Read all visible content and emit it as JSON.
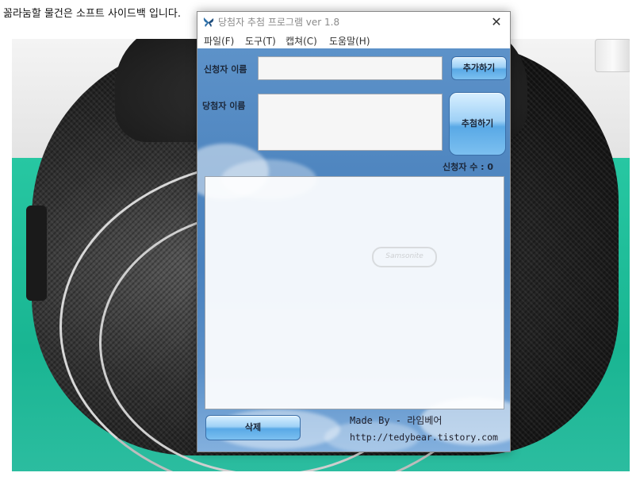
{
  "page": {
    "top_text": "꼶라눔할 물건은 소프트 사이드백 입니다."
  },
  "window": {
    "title": "당첨자 추첨 프로그램 ver 1.8",
    "close_glyph": "✕"
  },
  "menu": [
    {
      "label": "파일(F)"
    },
    {
      "label": "도구(T)"
    },
    {
      "label": "캡쳐(C)"
    },
    {
      "label": "도움말(H)"
    }
  ],
  "form": {
    "applicant_label": "신청자 이름",
    "applicant_value": "",
    "winner_label": "당첨자 이름",
    "winner_value": "",
    "add_button": "추가하기",
    "draw_button": "추첨하기",
    "count_text": "신청자 수 : 0",
    "delete_button": "삭제"
  },
  "list": {
    "items": [],
    "watermark": "Samsonite"
  },
  "credits": {
    "made_by": "Made By - 라임베어",
    "url": "http://tedybear.tistory.com"
  },
  "colors": {
    "sky": "#4f86c0",
    "button": "#7cc0f0",
    "accent_text": "#1b2638"
  }
}
